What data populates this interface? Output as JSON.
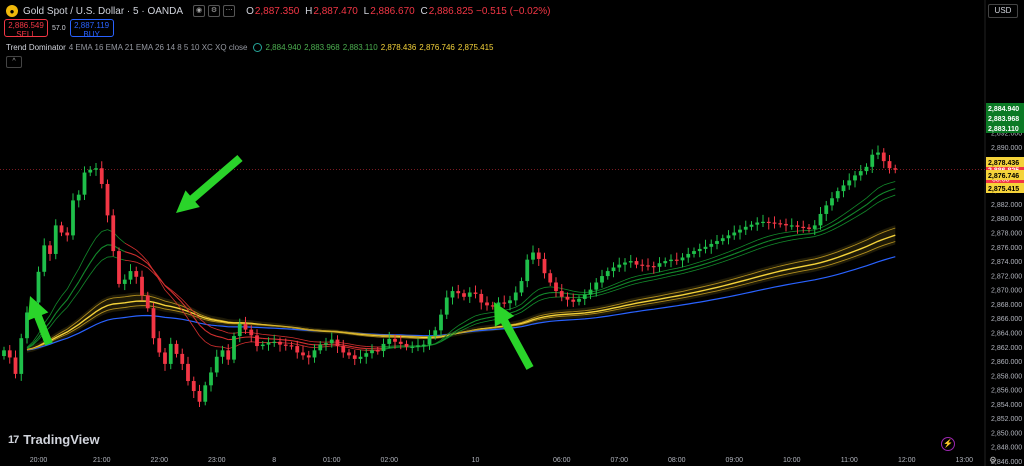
{
  "header": {
    "symbol_icon": "gold-coin-icon",
    "symbol": "Gold Spot / U.S. Dollar · 5 · OANDA",
    "ohlc": [
      {
        "k": "O",
        "v": "2,887.350"
      },
      {
        "k": "H",
        "v": "2,887.470"
      },
      {
        "k": "L",
        "v": "2,886.670"
      },
      {
        "k": "C",
        "v": "2,886.825"
      },
      {
        "k": "",
        "v": "−0.515 (−0.02%)"
      }
    ],
    "currency": "USD",
    "sell_price": "2,886.549",
    "sell_label": "SELL",
    "spread": "57.0",
    "buy_price": "2,887.119",
    "buy_label": "BUY",
    "collapse": "^"
  },
  "indicator": {
    "name": "Trend Dominator",
    "params": "4 EMA 16 EMA 21 EMA 26 14 8 5 10 XC XQ close",
    "values_green": [
      "2,884.940",
      "2,883.968",
      "2,883.110"
    ],
    "values_yellow": [
      "2,878.436",
      "2,876.746",
      "2,875.415"
    ]
  },
  "brand": {
    "logo": "TradingView",
    "mark": "17"
  },
  "colors": {
    "up": "#1fbf4a",
    "down": "#f23645",
    "ema_blue": "#2962ff",
    "ribbon_green": "#138a2b",
    "ribbon_red": "#d32f2f",
    "ribbon_yellow": "#f5d33a",
    "arrow": "#2ad42a",
    "bg": "#000000"
  },
  "chart_data": {
    "type": "candlestick",
    "title": "Gold Spot / U.S. Dollar · 5 · OANDA",
    "ylim": [
      2845,
      2895
    ],
    "yticks": [
      2846,
      2848,
      2850,
      2852,
      2854,
      2856,
      2858,
      2860,
      2862,
      2864,
      2866,
      2868,
      2870,
      2872,
      2874,
      2876,
      2878,
      2880,
      2882,
      2884,
      2886,
      2888,
      2890,
      2892,
      2894
    ],
    "xlim": [
      0,
      162
    ],
    "x_ticks": [
      {
        "i": 6,
        "label": "20:00"
      },
      {
        "i": 17,
        "label": "21:00"
      },
      {
        "i": 27,
        "label": "22:00"
      },
      {
        "i": 37,
        "label": "23:00"
      },
      {
        "i": 47,
        "label": "8"
      },
      {
        "i": 57,
        "label": "01:00"
      },
      {
        "i": 67,
        "label": "02:00"
      },
      {
        "i": 82,
        "label": "10"
      },
      {
        "i": 97,
        "label": "06:00"
      },
      {
        "i": 107,
        "label": "07:00"
      },
      {
        "i": 117,
        "label": "08:00"
      },
      {
        "i": 127,
        "label": "09:00"
      },
      {
        "i": 137,
        "label": "10:00"
      },
      {
        "i": 147,
        "label": "11:00"
      },
      {
        "i": 157,
        "label": "12:00"
      },
      {
        "i": 167,
        "label": "13:00"
      }
    ],
    "current_price": {
      "value": 2886.825,
      "label": "2,886.825",
      "countdown": "03:58"
    },
    "price_tags_green": [
      2884.94,
      2883.968,
      2883.11
    ],
    "price_tags_yellow": [
      2878.436,
      2876.746,
      2875.415
    ],
    "closes": [
      2861.5,
      2860.5,
      2858.2,
      2863.2,
      2866.8,
      2868.2,
      2872.5,
      2876.2,
      2875.0,
      2879.0,
      2878.0,
      2877.6,
      2882.5,
      2883.3,
      2886.4,
      2886.8,
      2887.0,
      2884.8,
      2880.4,
      2875.4,
      2870.8,
      2871.4,
      2872.6,
      2871.8,
      2869.2,
      2867.4,
      2863.2,
      2861.2,
      2859.6,
      2862.4,
      2861.0,
      2859.6,
      2857.2,
      2855.8,
      2854.3,
      2856.6,
      2858.4,
      2860.6,
      2861.5,
      2860.2,
      2863.5,
      2865.2,
      2864.4,
      2863.6,
      2862.1,
      2862.3,
      2862.6,
      2862.7,
      2862.3,
      2862.2,
      2862.1,
      2861.2,
      2860.8,
      2860.5,
      2861.5,
      2862.3,
      2862.5,
      2863.0,
      2862.1,
      2861.2,
      2860.8,
      2860.3,
      2860.6,
      2861.1,
      2861.5,
      2861.4,
      2862.4,
      2863.1,
      2862.7,
      2862.4,
      2862.0,
      2862.0,
      2862.2,
      2862.3,
      2863.5,
      2864.3,
      2866.5,
      2868.9,
      2869.8,
      2869.5,
      2869.0,
      2869.6,
      2869.4,
      2868.2,
      2867.8,
      2867.7,
      2868.2,
      2868.1,
      2868.5,
      2869.6,
      2871.2,
      2874.2,
      2875.2,
      2874.3,
      2872.3,
      2871.0,
      2869.8,
      2869.0,
      2868.6,
      2868.3,
      2868.7,
      2869.3,
      2870.0,
      2871.0,
      2871.9,
      2872.6,
      2873.1,
      2873.5,
      2873.8,
      2874.0,
      2873.5,
      2873.4,
      2873.3,
      2873.2,
      2873.7,
      2874.0,
      2874.2,
      2874.1,
      2874.5,
      2875.0,
      2875.4,
      2875.7,
      2876.0,
      2876.4,
      2876.8,
      2877.2,
      2877.6,
      2878.0,
      2878.4,
      2878.8,
      2879.1,
      2879.4,
      2879.5,
      2879.4,
      2879.3,
      2879.2,
      2879.0,
      2879.0,
      2878.8,
      2878.7,
      2878.5,
      2879.0,
      2880.6,
      2881.8,
      2882.8,
      2883.8,
      2884.6,
      2885.3,
      2886.0,
      2886.6,
      2887.2,
      2888.9,
      2889.2,
      2888.0,
      2887.0,
      2886.8
    ]
  }
}
